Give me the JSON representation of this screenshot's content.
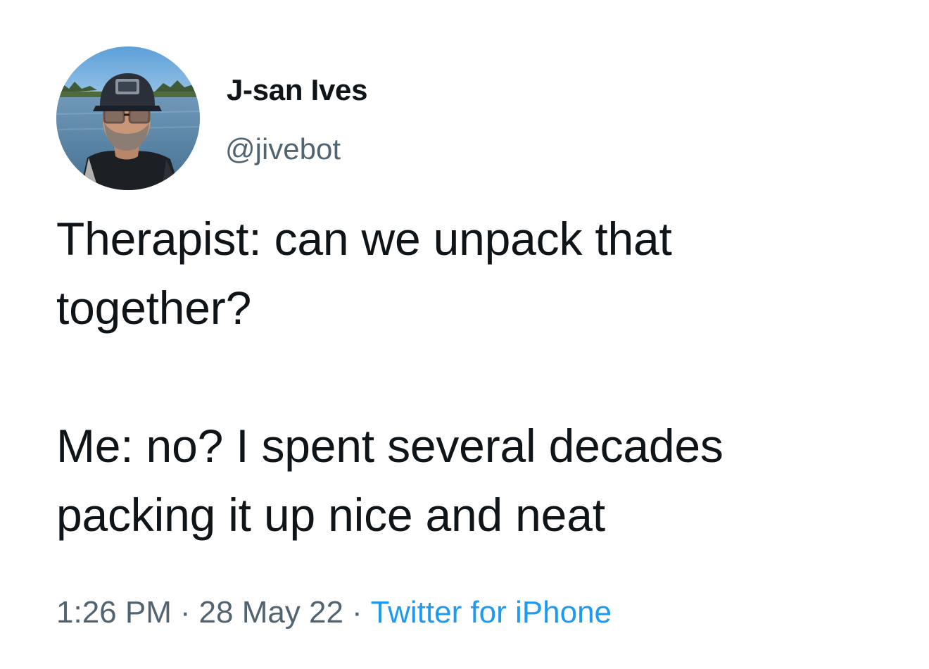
{
  "author": {
    "name": "J-san Ives",
    "handle": "@jivebot"
  },
  "tweet": {
    "paragraphs": [
      [
        "Therapist: can we unpack that",
        "together?"
      ],
      [
        "Me: no? I spent several decades",
        "packing it up nice and neat"
      ]
    ]
  },
  "meta": {
    "time": "1:26 PM",
    "separator": "·",
    "date": "28 May 22",
    "source": "Twitter for iPhone"
  },
  "colors": {
    "text": "#0f1419",
    "secondary": "#536471",
    "link": "#1d9bf0"
  }
}
